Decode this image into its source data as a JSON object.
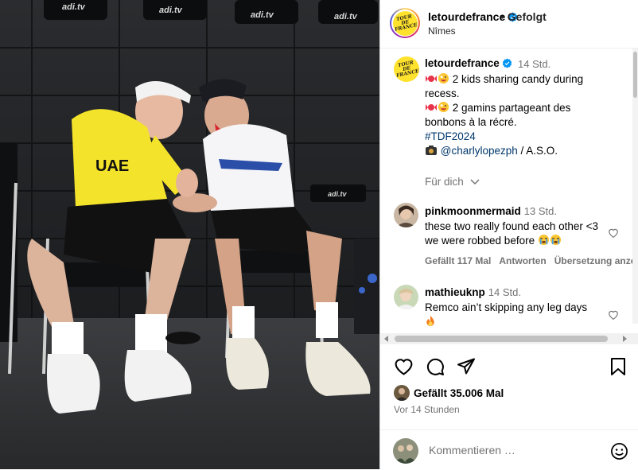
{
  "photo": {
    "sign_text": "adi.tv",
    "jersey_text": "UAE"
  },
  "header": {
    "username": "letourdefrance",
    "follow_status": "• Gefolgt",
    "location": "Nîmes",
    "logo_text": "TOUR DE FRANCE"
  },
  "caption": {
    "username": "letourdefrance",
    "time": "14 Std.",
    "line1_text": " 2 kids sharing candy during recess.",
    "line2_text": " 2 gamins partageant des bonbons à la récré.",
    "hashtag": "#TDF2024",
    "mention": "@charlylopezph",
    "credit_suffix": " / A.S.O.",
    "fuer_dich": "Für dich"
  },
  "comments": [
    {
      "username": "pinkmoonmermaid",
      "time": "13 Std.",
      "text": "these two really found each other <3 we were robbed before",
      "likes": "Gefällt 117 Mal",
      "reply": "Antworten",
      "translate": "Übersetzung anzei"
    },
    {
      "username": "mathieuknp",
      "time": "14 Std.",
      "text": "Remco ain’t skipping any leg days"
    }
  ],
  "engagement": {
    "likes_text": "Gefällt 35.006 Mal",
    "timestamp": "Vor 14 Stunden"
  },
  "add_comment": {
    "placeholder": "Kommentieren …"
  },
  "colors": {
    "link": "#00376b",
    "muted": "#737373",
    "verified": "#0095f6",
    "tdf_yellow": "#ffe22e"
  }
}
